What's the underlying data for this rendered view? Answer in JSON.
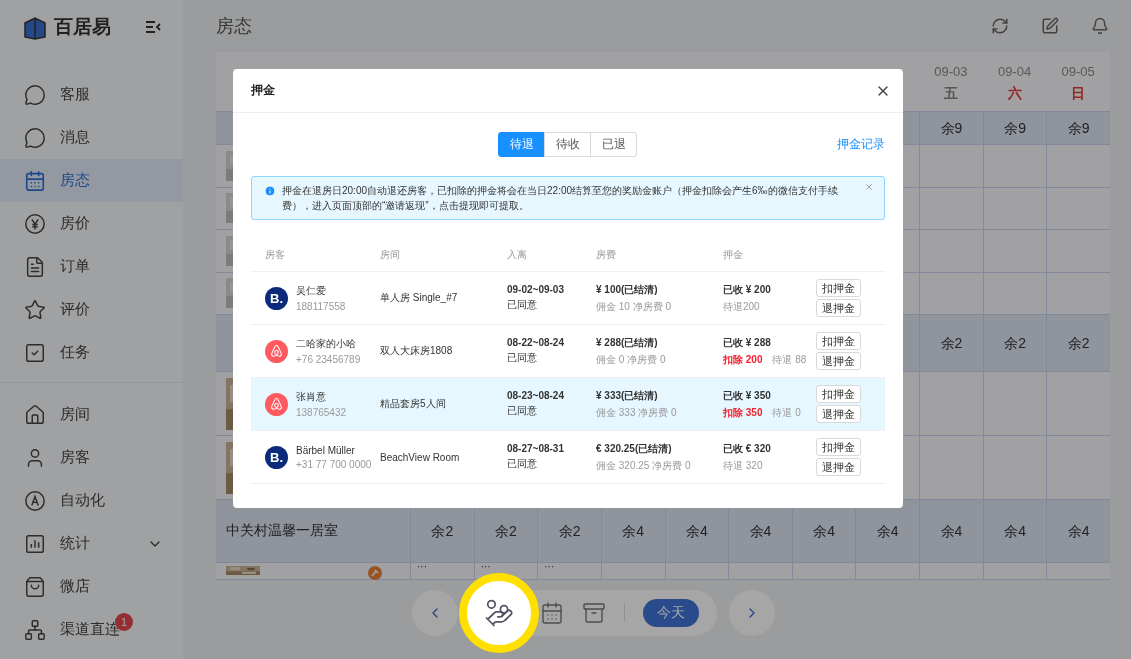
{
  "app": {
    "logo": "百居易"
  },
  "sidebar": {
    "sections": [
      {
        "items": [
          {
            "label": "客服",
            "selected": false
          },
          {
            "label": "消息",
            "selected": false
          },
          {
            "label": "房态",
            "selected": true
          },
          {
            "label": "房价",
            "selected": false
          },
          {
            "label": "订单",
            "selected": false
          },
          {
            "label": "评价",
            "selected": false
          },
          {
            "label": "任务",
            "selected": false
          }
        ]
      },
      {
        "items": [
          {
            "label": "房间",
            "selected": false
          },
          {
            "label": "房客",
            "selected": false
          },
          {
            "label": "自动化",
            "selected": false
          },
          {
            "label": "统计",
            "selected": false,
            "expandable": true
          },
          {
            "label": "微店",
            "selected": false
          },
          {
            "label": "渠道直连",
            "selected": false,
            "badge": "1"
          }
        ]
      }
    ]
  },
  "header": {
    "title": "房态"
  },
  "calendar": {
    "date_headers": [
      {
        "date": "09-03",
        "weekday": "五",
        "weekend": false
      },
      {
        "date": "09-04",
        "weekday": "六",
        "weekend": true
      },
      {
        "date": "09-05",
        "weekday": "日",
        "weekend": true
      }
    ],
    "rows": [
      {
        "kind": "availability",
        "cells": [
          "余9",
          "余9",
          "余9"
        ]
      },
      {
        "kind": "room"
      },
      {
        "kind": "room"
      },
      {
        "kind": "room"
      },
      {
        "kind": "room"
      },
      {
        "kind": "availability",
        "cells": [
          "余2",
          "余2",
          "余2"
        ]
      },
      {
        "kind": "room"
      },
      {
        "kind": "room"
      },
      {
        "kind": "availability",
        "name": "中关村温馨一居室",
        "cells": [
          "余2",
          "余2",
          "余2",
          "余4",
          "余4",
          "余4",
          "余4",
          "余4",
          "余4",
          "余4",
          "余4"
        ]
      },
      {
        "kind": "partial",
        "cells": [
          "···",
          "···",
          "···"
        ]
      }
    ]
  },
  "toolbar": {
    "highlighted": true,
    "today": "今天"
  },
  "modal": {
    "title": "押金",
    "tabs": [
      {
        "label": "待退",
        "selected": true
      },
      {
        "label": "待收",
        "selected": false
      },
      {
        "label": "已退",
        "selected": false
      }
    ],
    "link": "押金记录",
    "notice": "押金在退房日20:00自动退还房客，已扣除的押金将会在当日22:00结算至您的奖励金账户（押金扣除会产生6‰的微信支付手续费），进入页面顶部的“邀请返现”，点击提现即可提取。",
    "columns": [
      "房客",
      "房间",
      "入离",
      "房费",
      "押金"
    ],
    "rows": [
      {
        "source": {
          "kind": "booking",
          "mark": "B."
        },
        "name": "吴仁爱",
        "phone": "188117558",
        "room": "单人房 Single_#7",
        "dates": "09-02~09-03",
        "status": "已同意",
        "fee": "¥ 100(已结清)",
        "fee_detail": "佣金 10 净房费 0",
        "received": "已收 ¥ 200",
        "pending": "待退200",
        "actions": [
          "扣押金",
          "退押金"
        ],
        "selected": false
      },
      {
        "source": {
          "kind": "airbnb"
        },
        "name": "二哈家的小哈",
        "phone": "+76 23456789",
        "room": "双人大床房1808",
        "dates": "08-22~08-24",
        "status": "已同意",
        "fee": "¥ 288(已结清)",
        "fee_detail": "佣金 0 净房费 0",
        "received": "已收 ¥ 288",
        "deducted": "扣除 200",
        "pending": "待退 88",
        "actions": [
          "扣押金",
          "退押金"
        ],
        "selected": false
      },
      {
        "source": {
          "kind": "airbnb"
        },
        "name": "张肖意",
        "phone": "138765432",
        "room": "精品套房5人间",
        "dates": "08-23~08-24",
        "status": "已同意",
        "fee": "¥ 333(已结清)",
        "fee_detail": "佣金 333 净房费 0",
        "received": "已收 ¥ 350",
        "deducted": "扣除 350",
        "pending": "待退 0",
        "actions": [
          "扣押金",
          "退押金"
        ],
        "selected": true
      },
      {
        "source": {
          "kind": "booking",
          "mark": "B."
        },
        "name": "Bärbel Müller",
        "phone": "+31 77 700 0000",
        "room": "BeachView Room",
        "dates": "08-27~08-31",
        "status": "已同意",
        "fee": "€ 320.25(已结清)",
        "fee_detail": "佣金 320.25 净房费 0",
        "received": "已收 € 320",
        "pending": "待退 320",
        "actions": [
          "扣押金",
          "退押金"
        ],
        "selected": false
      }
    ]
  }
}
